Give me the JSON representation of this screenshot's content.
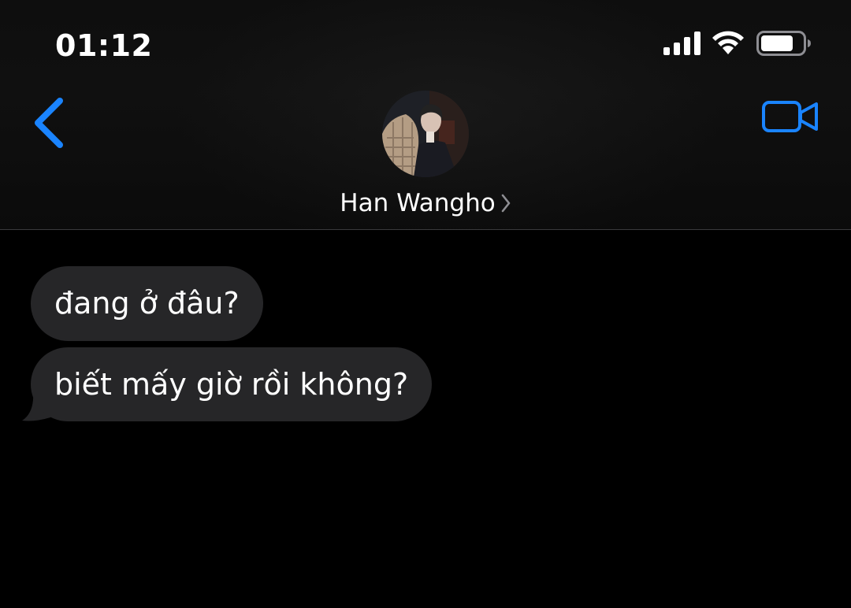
{
  "status_bar": {
    "time": "01:12",
    "signal_icon": "cellular-signal-icon",
    "wifi_icon": "wifi-icon",
    "battery_icon": "battery-icon"
  },
  "header": {
    "back_icon": "chevron-left-icon",
    "contact_name": "Han Wangho",
    "contact_chevron_icon": "chevron-right-icon",
    "video_icon": "video-camera-icon",
    "accent_color": "#1a84ff"
  },
  "messages": [
    {
      "text": "đang ở đâu?",
      "direction": "incoming"
    },
    {
      "text": "biết mấy giờ rồi không?",
      "direction": "incoming"
    }
  ],
  "colors": {
    "background": "#000000",
    "bubble_incoming": "#262628",
    "text": "#ffffff"
  }
}
